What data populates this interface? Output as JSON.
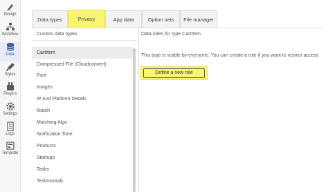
{
  "sidebar": {
    "items": [
      {
        "label": "Design",
        "icon": "design-icon"
      },
      {
        "label": "Workflow",
        "icon": "workflow-icon"
      },
      {
        "label": "Data",
        "icon": "database-icon",
        "active": true
      },
      {
        "label": "Styles",
        "icon": "styles-icon"
      },
      {
        "label": "Plugins",
        "icon": "plugins-icon"
      },
      {
        "label": "Settings",
        "icon": "settings-icon"
      },
      {
        "label": "Logs",
        "icon": "logs-icon"
      },
      {
        "label": "Template",
        "icon": "template-icon"
      }
    ]
  },
  "tabs": [
    {
      "label": "Data types"
    },
    {
      "label": "Privacy",
      "active": true
    },
    {
      "label": "App data"
    },
    {
      "label": "Option sets"
    },
    {
      "label": "File manager"
    }
  ],
  "list_header": "Custom data types",
  "data_types": [
    "CartItem",
    "Compressed File (Cloudconvert)",
    "Font",
    "Images",
    "IP And Platform Details",
    "Match",
    "Matching Algo",
    "Notification Tone",
    "Products",
    "Startups",
    "Tasks",
    "Testimonials"
  ],
  "selected_type": "CartItem",
  "privacy": {
    "header": "Data roles for type CartItem",
    "visibility_text": "This type is visible by everyone. You can create a role if you want to restrict access",
    "define_role_button": "Define a new role"
  },
  "colors": {
    "highlight": "#f8f572",
    "highlight_border": "#e8e44a",
    "active_sidebar": "#3b5bb5"
  }
}
